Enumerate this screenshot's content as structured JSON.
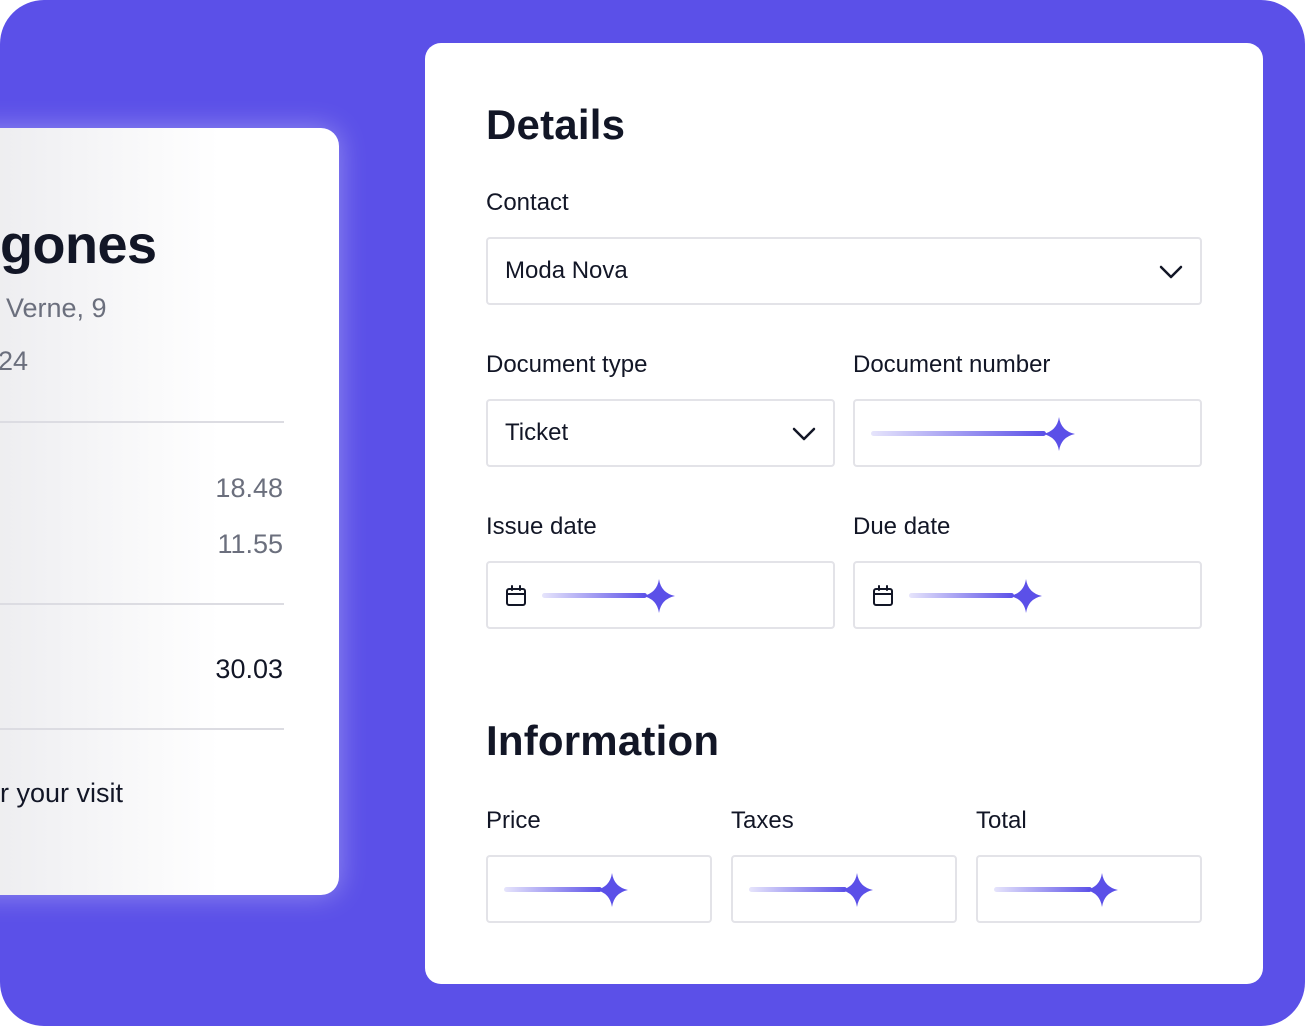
{
  "receipt": {
    "store_partial": "gones",
    "address_partial": "Verne, 9",
    "date_partial": "24",
    "line_values": [
      "18.48",
      "11.55"
    ],
    "total_value": "30.03",
    "footer_partial": "r your visit"
  },
  "details": {
    "title": "Details",
    "contact_label": "Contact",
    "contact_value": "Moda Nova",
    "document_type_label": "Document type",
    "document_type_value": "Ticket",
    "document_number_label": "Document number",
    "issue_date_label": "Issue date",
    "due_date_label": "Due date"
  },
  "information": {
    "title": "Information",
    "price_label": "Price",
    "taxes_label": "Taxes",
    "total_label": "Total"
  },
  "icons": {
    "loading": "sparkle-icon",
    "dropdown": "chevron-down-icon",
    "date": "calendar-icon"
  },
  "colors": {
    "background": "#5B50E8",
    "accent": "#5B50E8",
    "text": "#121626",
    "muted_text": "#6b6f7d",
    "field_border": "#e3e3e8"
  }
}
